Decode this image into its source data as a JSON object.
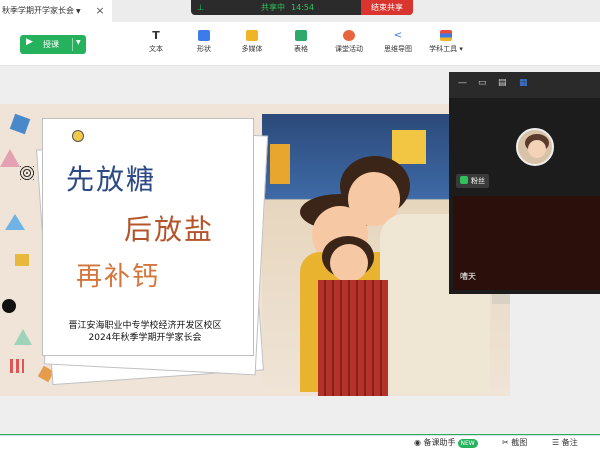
{
  "tab": {
    "title": "秋季学期开学家长会",
    "close": "×"
  },
  "share": {
    "status": "共享中",
    "time": "14:54",
    "end_label": "结束共享"
  },
  "toolbar": {
    "lesson_label": "授课",
    "tools": [
      {
        "label": "文本",
        "color": "#333333"
      },
      {
        "label": "形状",
        "color": "#3c7be8"
      },
      {
        "label": "多媒体",
        "color": "#f0b429"
      },
      {
        "label": "表格",
        "color": "#2fa86b"
      },
      {
        "label": "课堂活动",
        "color": "#e8643c"
      },
      {
        "label": "思维导图",
        "color": "#3c7be8"
      },
      {
        "label": "学科工具",
        "color": "#e84c3d"
      }
    ]
  },
  "slide": {
    "line1": "先放糖",
    "line2": "后放盐",
    "line3": "再补钙",
    "school_line1": "晋江安海职业中专学校经济开发区校区",
    "school_line2": "2024年秋季学期开学家长会"
  },
  "video": {
    "participant1": "粉丝",
    "participant2": "嘈天"
  },
  "statusbar": {
    "assistant": "备课助手",
    "new_badge": "NEW",
    "screenshot": "截图",
    "notes": "备注"
  }
}
